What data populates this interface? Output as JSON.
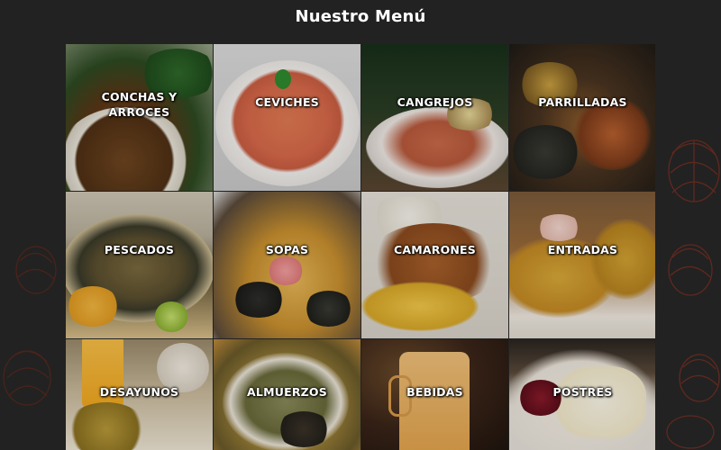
{
  "page": {
    "title": "Nuestro Menú"
  },
  "menu": {
    "items": [
      {
        "label": "CONCHAS Y ARROCES"
      },
      {
        "label": "CEVICHES"
      },
      {
        "label": "CANGREJOS"
      },
      {
        "label": "PARRILLADAS"
      },
      {
        "label": "PESCADOS"
      },
      {
        "label": "SOPAS"
      },
      {
        "label": "CAMARONES"
      },
      {
        "label": "ENTRADAS"
      },
      {
        "label": "DESAYUNOS"
      },
      {
        "label": "ALMUERZOS"
      },
      {
        "label": "BEBIDAS"
      },
      {
        "label": "POSTRES"
      }
    ]
  },
  "colors": {
    "background": "#222222",
    "title_text": "#ffffff",
    "label_text": "#ffffff",
    "decoration": "#6b2a1e"
  }
}
